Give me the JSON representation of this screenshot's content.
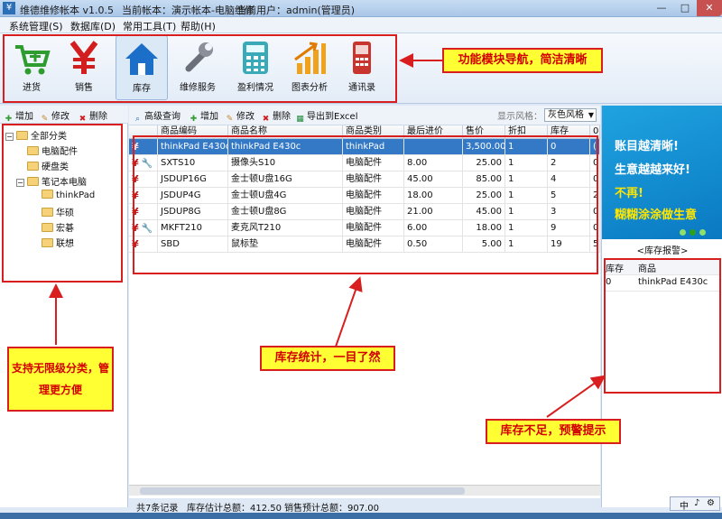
{
  "window": {
    "app_title": "维德维修帐本 v1.0.5",
    "account": "当前帐本：演示帐本-电脑维修",
    "user": "当前用户：admin(管理员)",
    "controls": [
      "—",
      "□",
      "✕"
    ]
  },
  "menu": [
    "系统管理(S)",
    "数据库(D)",
    "常用工具(T)",
    "帮助(H)"
  ],
  "modules": [
    {
      "label": "进货",
      "icon": "cart-plus-icon"
    },
    {
      "label": "销售",
      "icon": "yen-icon"
    },
    {
      "label": "库存",
      "icon": "house-icon"
    },
    {
      "label": "维修服务",
      "icon": "wrench-icon"
    },
    {
      "label": "盈利情况",
      "icon": "calculator-icon"
    },
    {
      "label": "图表分析",
      "icon": "bar-chart-icon"
    },
    {
      "label": "通讯录",
      "icon": "phone-icon"
    }
  ],
  "selected_module": "库存",
  "callouts": {
    "nav": "功能模块导航，简洁清晰",
    "category": "支持无限级分类，管理更方便",
    "inventory": "库存统计，一目了然",
    "alarm": "库存不足，预警提示"
  },
  "left_toolbar": [
    "增加",
    "修改",
    "删除"
  ],
  "tree": {
    "root": "全部分类",
    "nodes": [
      {
        "label": "电脑配件",
        "level": 1
      },
      {
        "label": "硬盘类",
        "level": 1
      },
      {
        "label": "笔记本电脑",
        "level": 1,
        "expanded": true
      },
      {
        "label": "thinkPad",
        "level": 2
      },
      {
        "label": "华硕",
        "level": 2
      },
      {
        "label": "宏碁",
        "level": 2
      },
      {
        "label": "联想",
        "level": 2
      }
    ]
  },
  "center_toolbar": [
    "高级查询",
    "增加",
    "修改",
    "删除",
    "导出到Excel"
  ],
  "style_label": "显示风格：",
  "style_value": "灰色风格",
  "columns": [
    "商品编码",
    "商品名称",
    "商品类别",
    "最后进价",
    "售价",
    "折扣",
    "库存",
    "0"
  ],
  "rows": [
    {
      "code": "thinkPad E430c",
      "name": "thinkPad E430c",
      "category": "thinkPad",
      "cost": "",
      "price": "3,500.00",
      "discount": "1",
      "stock": "0",
      "extra": "(",
      "service": false
    },
    {
      "code": "SXTS10",
      "name": "摄像头S10",
      "category": "电脑配件",
      "cost": "8.00",
      "price": "25.00",
      "discount": "1",
      "stock": "2",
      "extra": "0",
      "service": true
    },
    {
      "code": "JSDUP16G",
      "name": "金士顿U盘16G",
      "category": "电脑配件",
      "cost": "45.00",
      "price": "85.00",
      "discount": "1",
      "stock": "4",
      "extra": "0",
      "service": false
    },
    {
      "code": "JSDUP4G",
      "name": "金士顿U盘4G",
      "category": "电脑配件",
      "cost": "18.00",
      "price": "25.00",
      "discount": "1",
      "stock": "5",
      "extra": "2",
      "service": false
    },
    {
      "code": "JSDUP8G",
      "name": "金士顿U盘8G",
      "category": "电脑配件",
      "cost": "21.00",
      "price": "45.00",
      "discount": "1",
      "stock": "3",
      "extra": "0",
      "service": false
    },
    {
      "code": "MKFT210",
      "name": "麦克风T210",
      "category": "电脑配件",
      "cost": "6.00",
      "price": "18.00",
      "discount": "1",
      "stock": "9",
      "extra": "0",
      "service": true
    },
    {
      "code": "SBD",
      "name": "鼠标垫",
      "category": "电脑配件",
      "cost": "0.50",
      "price": "5.00",
      "discount": "1",
      "stock": "19",
      "extra": "5",
      "service": false
    }
  ],
  "banner": [
    "账目越清晰!",
    "生意越越来好!",
    "不再!",
    "糊糊涂涂做生意"
  ],
  "alarm": {
    "title": "<库存报警>",
    "columns": [
      "库存",
      "商品"
    ],
    "rows": [
      {
        "stock": "0",
        "name": "thinkPad E430c"
      }
    ]
  },
  "status": {
    "count": "共7条记录",
    "stock_total": "库存估计总额：412.50",
    "sales_total": "销售预计总额：907.00"
  },
  "ime": [
    "中",
    "♪",
    "⚙"
  ]
}
